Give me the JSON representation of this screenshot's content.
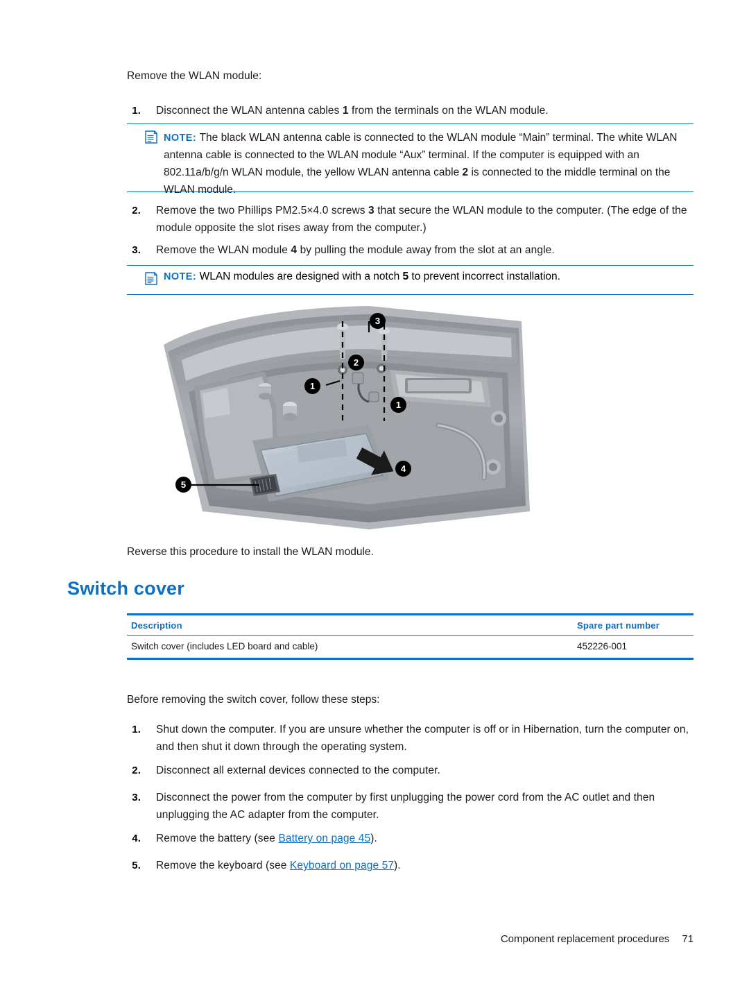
{
  "intro": "Remove the WLAN module:",
  "steps_top": [
    {
      "num": "1.",
      "text_parts": [
        "Disconnect the WLAN antenna cables ",
        "1",
        " from the terminals on the WLAN module."
      ]
    },
    {
      "num": "2.",
      "text_parts": [
        "Remove the two Phillips PM2.5×4.0 screws ",
        "3",
        " that secure the WLAN module to the computer. (The edge of the module opposite the slot rises away from the computer.)"
      ]
    },
    {
      "num": "3.",
      "text_parts": [
        "Remove the WLAN module ",
        "4",
        " by pulling the module away from the slot at an angle."
      ]
    }
  ],
  "note1": {
    "label": "NOTE:",
    "text_a": "The black WLAN antenna cable is connected to the WLAN module “Main” terminal. The white WLAN antenna cable is connected to the WLAN module “Aux” terminal. If the computer is equipped with an 802.11a/b/g/n WLAN module, the yellow WLAN antenna cable ",
    "bold": "2",
    "text_b": " is connected to the middle terminal on the WLAN module."
  },
  "note2": {
    "label": "NOTE:",
    "text_a": "WLAN modules are designed with a notch ",
    "bold": "5",
    "text_b": " to prevent incorrect installation."
  },
  "figure": {
    "callouts": [
      "1",
      "1",
      "2",
      "3",
      "4",
      "5"
    ],
    "alt": "WLAN module removal illustration"
  },
  "reverse_line": "Reverse this procedure to install the WLAN module.",
  "section_title": "Switch cover",
  "table": {
    "headers": [
      "Description",
      "Spare part number"
    ],
    "rows": [
      [
        "Switch cover (includes LED board and cable)",
        "452226-001"
      ]
    ]
  },
  "before_line": "Before removing the switch cover, follow these steps:",
  "steps_bottom": [
    {
      "num": "1.",
      "text": "Shut down the computer. If you are unsure whether the computer is off or in Hibernation, turn the computer on, and then shut it down through the operating system."
    },
    {
      "num": "2.",
      "text": "Disconnect all external devices connected to the computer."
    },
    {
      "num": "3.",
      "text": "Disconnect the power from the computer by first unplugging the power cord from the AC outlet and then unplugging the AC adapter from the computer."
    },
    {
      "num": "4.",
      "pre": "Remove the battery (see ",
      "link": "Battery on page 45",
      "post": ")."
    },
    {
      "num": "5.",
      "pre": "Remove the keyboard (see ",
      "link": "Keyboard on page 57",
      "post": ")."
    }
  ],
  "footer": {
    "text": "Component replacement procedures",
    "page": "71"
  },
  "colors": {
    "accent": "#0b6fc4",
    "text": "#1a1a1a"
  }
}
